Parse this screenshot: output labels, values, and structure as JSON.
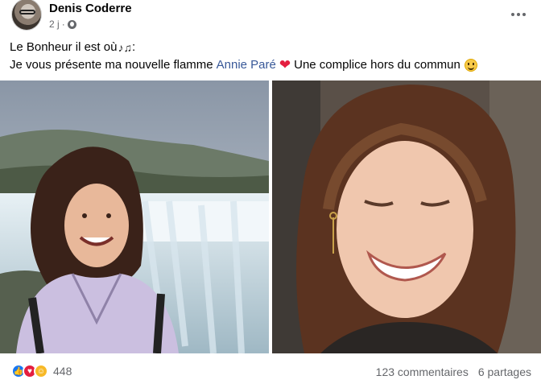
{
  "post": {
    "author": "Denis Coderre",
    "time": "2 j",
    "visibility_icon": "globe-icon",
    "more_icon": "more-options-icon",
    "text_line1": "Le Bonheur il est où",
    "text_line1_end": ":",
    "text_line2_prefix": "Je vous présente ma nouvelle flamme",
    "mention": "Annie Paré",
    "text_line2_suffix": "Une complice hors du commun"
  },
  "photos": [
    {
      "name": "photo-waterfall",
      "description_icon": "photo"
    },
    {
      "name": "photo-portrait",
      "description_icon": "photo"
    }
  ],
  "footer": {
    "reaction_icons": [
      "like-icon",
      "love-icon",
      "care-icon"
    ],
    "reaction_count": "448",
    "comments": "123 commentaires",
    "shares": "6 partages"
  },
  "colors": {
    "mention": "#385898",
    "like": "#1877f2",
    "love": "#e41e3f",
    "care": "#f7b928",
    "meta": "#65676b"
  }
}
